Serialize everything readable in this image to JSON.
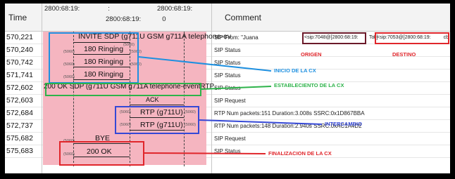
{
  "header": {
    "time_label": "Time",
    "host_left": "2800:68:19:",
    "host_left_suffix": ":",
    "host_right": "2800:68:19:",
    "host_right_suffix": "cb",
    "host_mid": "2800:68:19:",
    "host_mid_suffix": "0",
    "comment_label": "Comment"
  },
  "rows": [
    {
      "time": "570,221",
      "comment": "SIP From: \"Juana"
    },
    {
      "time": "570,240",
      "comment": "SIP Status"
    },
    {
      "time": "570,742",
      "comment": "SIP Status"
    },
    {
      "time": "571,741",
      "comment": "SIP Status"
    },
    {
      "time": "572,602",
      "comment": "SIP Status"
    },
    {
      "time": "572,603",
      "comment": "SIP Request"
    },
    {
      "time": "572,684",
      "comment": "RTP Num packets:151  Duration:3.008s SSRC:0x1D867BBA"
    },
    {
      "time": "572,737",
      "comment": "RTP Num packets:148  Duration:2.940s SSRC:0xAC1A4D2"
    },
    {
      "time": "575,682",
      "comment": "SIP Request"
    },
    {
      "time": "575,683",
      "comment": "SIP Status"
    }
  ],
  "flow": {
    "invite": "INVITE SDP (g711U GSM g711A telephone-ev",
    "ringing1": "180 Ringing",
    "ringing2": "180 Ringing",
    "ringing3": "180 Ringing",
    "ok": "200 OK SDP (g711U GSM g711A telephone-eventRTP",
    "ack": "ACK",
    "rtp1": "RTP (g711U)",
    "rtp2": "RTP (g711U)",
    "bye": "BYE",
    "ok2": "200 OK",
    "port": "(5060)"
  },
  "sip_from": {
    "from_prefix": "<sip:7048@[2800:68:19:",
    "from_suffix": "0]",
    "to_label": "To",
    "to_prefix": "<sip:7053@[2800:68:19:",
    "to_suffix": "cb"
  },
  "annotations": {
    "origen": "ORIGEN",
    "destino": "DESTINO",
    "inicio": "INICIO DE LA CX",
    "establecimiento": "ESTABLECIENTO DE LA CX",
    "intercambio": "INTERCAMBIO",
    "finalizacion": "FINALIZACION DE LA CX"
  },
  "colors": {
    "inicio": "#1e90e0",
    "establecimiento": "#2db34a",
    "intercambio": "#3548d6",
    "finalizacion": "#e0262b",
    "origen_box": "#6b1a2a",
    "flow_bg": "#f5b5c0"
  }
}
